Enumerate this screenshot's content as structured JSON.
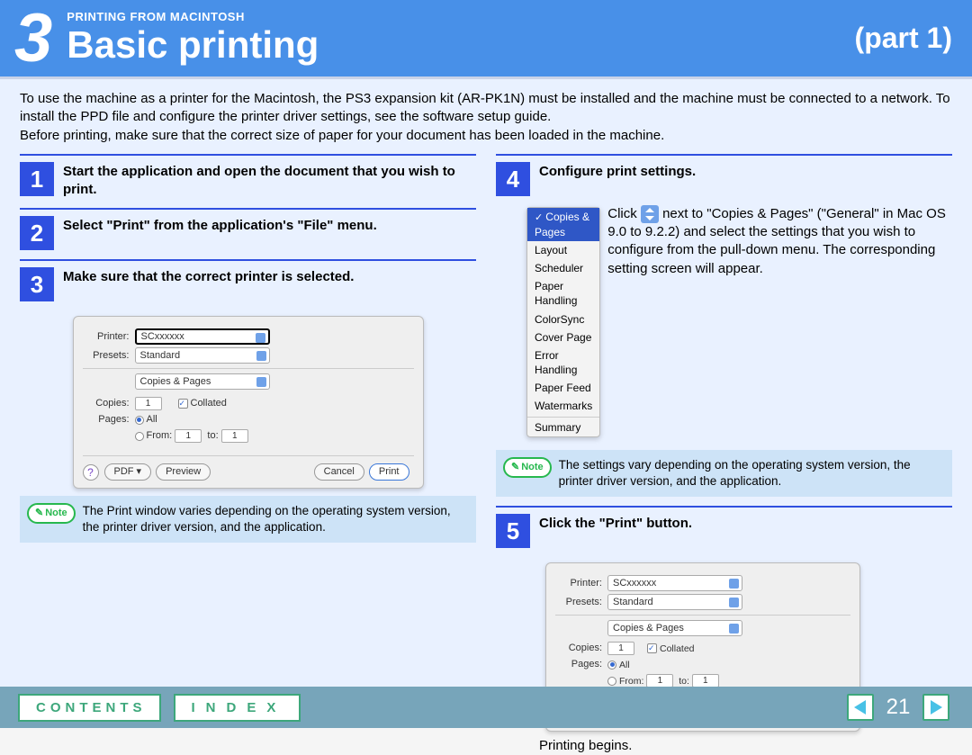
{
  "header": {
    "chapter_num": "3",
    "eyebrow": "PRINTING FROM MACINTOSH",
    "title": "Basic printing",
    "part": "(part 1)"
  },
  "intro": {
    "p1": "To use the machine as a printer for the Macintosh, the PS3 expansion kit (AR-PK1N) must be installed and the machine must be connected to a network. To install the PPD file and configure the printer driver settings, see the software setup guide.",
    "p2": "Before printing, make sure that the correct size of paper for your document has been loaded in the machine."
  },
  "steps": {
    "s1": {
      "n": "1",
      "t": "Start the application and open the document that you wish to print."
    },
    "s2": {
      "n": "2",
      "t": "Select \"Print\" from the application's \"File\" menu."
    },
    "s3": {
      "n": "3",
      "t": "Make sure that the correct printer is selected."
    },
    "s4": {
      "n": "4",
      "t": "Configure print settings."
    },
    "s5": {
      "n": "5",
      "t": "Click the \"Print\" button."
    }
  },
  "dlg": {
    "printer_label": "Printer:",
    "printer_value": "SCxxxxxx",
    "presets_label": "Presets:",
    "presets_value": "Standard",
    "panel_value": "Copies & Pages",
    "copies_label": "Copies:",
    "copies_value": "1",
    "collated": "Collated",
    "pages_label": "Pages:",
    "all": "All",
    "from": "From:",
    "from_v": "1",
    "to": "to:",
    "to_v": "1",
    "help": "?",
    "pdf": "PDF ▾",
    "preview": "Preview",
    "cancel": "Cancel",
    "print": "Print"
  },
  "note1": {
    "label": "Note",
    "text": "The Print window varies depending on the operating system version, the printer driver version, and the application."
  },
  "menu": {
    "items": [
      "Copies & Pages",
      "Layout",
      "Scheduler",
      "Paper Handling",
      "ColorSync",
      "Cover Page",
      "Error Handling",
      "Paper Feed",
      "Watermarks",
      "Summary"
    ]
  },
  "step4text": {
    "a": "Click ",
    "b": " next to \"Copies & Pages\" (\"General\" in Mac OS 9.0 to 9.2.2) and select the settings that you wish to configure from the pull-down menu. The corresponding setting screen will appear."
  },
  "note2": {
    "label": "Note",
    "text": "The settings vary depending on the operating system version, the printer driver version, and the application."
  },
  "after5": "Printing begins.",
  "footer": {
    "contents": "CONTENTS",
    "index": "INDEX",
    "page": "21"
  }
}
